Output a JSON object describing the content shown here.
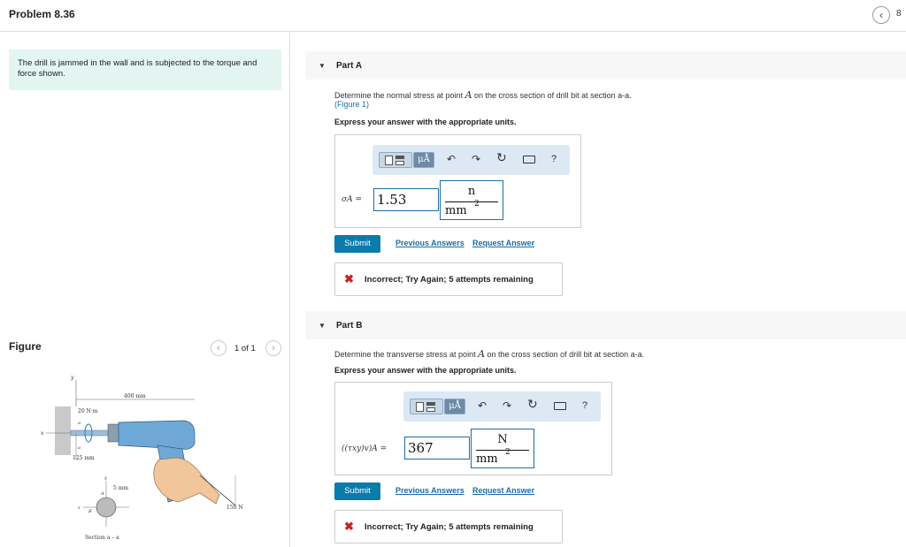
{
  "header": {
    "title": "Problem 8.36",
    "nav_prev": "‹",
    "nav_count": "8"
  },
  "intro": {
    "text": "The drill is jammed in the wall and is subjected to the torque and force shown."
  },
  "figure": {
    "label": "Figure",
    "counter": "1 of 1",
    "prev": "‹",
    "next": "›",
    "labels": {
      "y_top": "y",
      "x_left": "x",
      "dim_400": "400 mm",
      "torque": "20 N·m",
      "dim_125": "125 mm",
      "a_top": "a",
      "a_bottom": "a",
      "y_section": "y",
      "dim_5": "5 mm",
      "z_section": "z",
      "point_a": "A",
      "point_b": "B",
      "force": "150 N",
      "section": "Section a – a"
    }
  },
  "toolbar": {
    "mu_label": "μÅ",
    "undo": "↶",
    "redo": "↷",
    "reset": "↻",
    "help": "?"
  },
  "part_a": {
    "toggle": "▼",
    "title": "Part A",
    "prompt_before": "Determine the normal stress at point ",
    "prompt_var": "A",
    "prompt_after": " on the cross section of drill bit at section a-a.",
    "figure_link": "(Figure 1)",
    "instruction": "Express your answer with the appropriate units.",
    "variable_label": "σA =",
    "value": "1.53",
    "unit_numerator": "n",
    "unit_denominator": "mm",
    "unit_exponent": "2",
    "submit": "Submit",
    "previous_answers": "Previous Answers",
    "request_answer": "Request Answer",
    "feedback_icon": "✖",
    "feedback": "Incorrect; Try Again; 5 attempts remaining"
  },
  "part_b": {
    "toggle": "▼",
    "title": "Part B",
    "prompt_before": "Determine the transverse stress at point ",
    "prompt_var": "A",
    "prompt_after": " on the cross section of drill bit at section a-a.",
    "instruction": "Express your answer with the appropriate units.",
    "variable_label": "((τxy)v)A =",
    "value": "367",
    "unit_numerator": "N",
    "unit_denominator": "mm",
    "unit_exponent": "2",
    "submit": "Submit",
    "previous_answers": "Previous Answers",
    "request_answer": "Request Answer",
    "feedback_icon": "✖",
    "feedback": "Incorrect; Try Again; 5 attempts remaining"
  }
}
